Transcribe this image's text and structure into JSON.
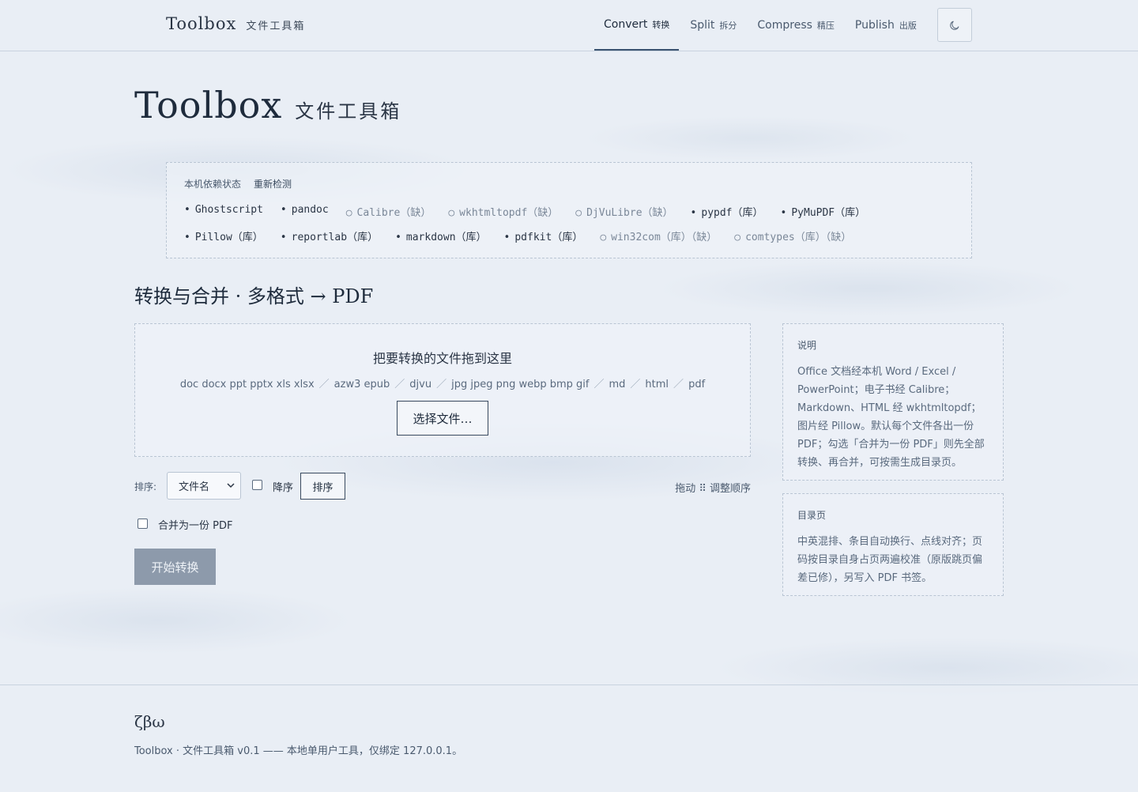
{
  "brand": {
    "en": "Toolbox",
    "zh": "文件工具箱"
  },
  "nav": [
    {
      "en": "Convert",
      "zh": "转换",
      "active": true
    },
    {
      "en": "Split",
      "zh": "拆分",
      "active": false
    },
    {
      "en": "Compress",
      "zh": "精压",
      "active": false
    },
    {
      "en": "Publish",
      "zh": "出版",
      "active": false
    }
  ],
  "theme_icon": "moon-icon",
  "hero": {
    "en": "Toolbox",
    "zh": "文件工具箱"
  },
  "deps": {
    "title": "本机依赖状态",
    "recheck": "重新检测",
    "row1": [
      {
        "name": "Ghostscript",
        "ok": true
      },
      {
        "name": "pandoc",
        "ok": true
      },
      {
        "name": "Calibre（缺）",
        "ok": false
      },
      {
        "name": "wkhtmltopdf（缺）",
        "ok": false
      },
      {
        "name": "DjVuLibre（缺）",
        "ok": false
      },
      {
        "name": "pypdf（库）",
        "ok": true
      },
      {
        "name": "PyMuPDF（库）",
        "ok": true
      }
    ],
    "row2": [
      {
        "name": "Pillow（库）",
        "ok": true
      },
      {
        "name": "reportlab（库）",
        "ok": true
      },
      {
        "name": "markdown（库）",
        "ok": true
      },
      {
        "name": "pdfkit（库）",
        "ok": true
      },
      {
        "name": "win32com（库）（缺）",
        "ok": false
      },
      {
        "name": "comtypes（库）（缺）",
        "ok": false
      }
    ]
  },
  "section_title": "转换与合并 · 多格式 → PDF",
  "dropzone": {
    "title": "把要转换的文件拖到这里",
    "formats": [
      "doc docx ppt pptx xls xlsx",
      "azw3 epub",
      "djvu",
      "jpg jpeg png webp bmp gif",
      "md",
      "html",
      "pdf"
    ],
    "separator": "／",
    "choose_label": "选择文件…"
  },
  "sort": {
    "label": "排序:",
    "selected": "文件名",
    "desc_label": "降序",
    "button": "排序",
    "drag_hint": "拖动 ⠿ 调整顺序"
  },
  "merge_label": "合并为一份 PDF",
  "start_label": "开始转换",
  "notes": [
    {
      "title": "说明",
      "body": "Office 文档经本机 Word / Excel / PowerPoint；电子书经 Calibre；Markdown、HTML 经 wkhtmltopdf；图片经 Pillow。默认每个文件各出一份 PDF；勾选「合并为一份 PDF」则先全部转换、再合并，可按需生成目录页。"
    },
    {
      "title": "目录页",
      "body": "中英混排、条目自动换行、点线对齐；页码按目录自身占页两遍校准（原版跳页偏差已修），另写入 PDF 书签。"
    }
  ],
  "footer": {
    "logo": "ζβω",
    "text": "Toolbox · 文件工具箱 v0.1 —— 本地单用户工具，仅绑定 127.0.0.1。"
  }
}
